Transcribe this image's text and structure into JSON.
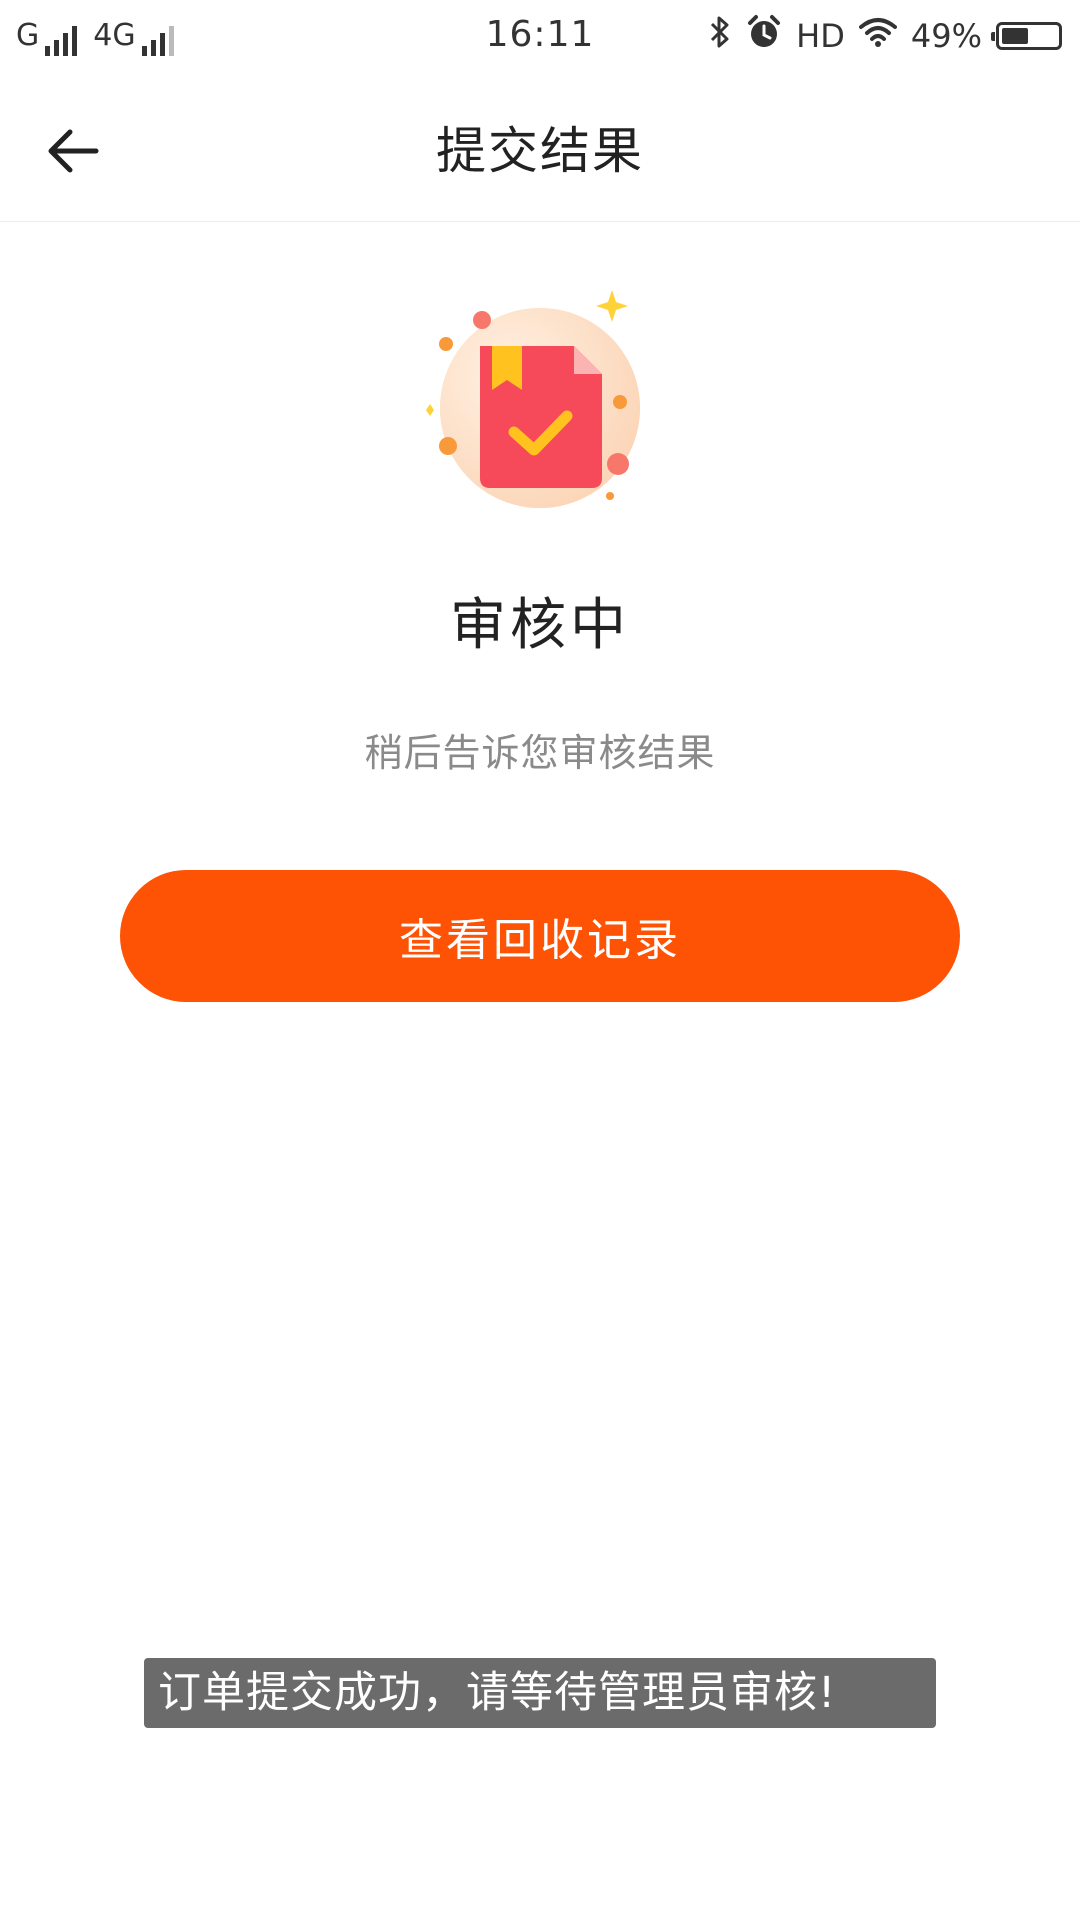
{
  "status_bar": {
    "carrier_1": "G",
    "carrier_2": "4G",
    "time": "16:11",
    "hd_label": "HD",
    "battery_percent": "49%",
    "battery_level": 0.49,
    "icons": [
      "signal-icon",
      "bluetooth-icon",
      "alarm-icon",
      "wifi-icon",
      "battery-icon"
    ]
  },
  "header": {
    "title": "提交结果",
    "back_icon": "arrow-left-icon"
  },
  "result": {
    "illustration_icon": "document-check-icon",
    "status_title": "审核中",
    "status_subtitle": "稍后告诉您审核结果",
    "button_label": "查看回收记录"
  },
  "toast": {
    "message": "订单提交成功，请等待管理员审核!"
  },
  "colors": {
    "accent": "#fe5305",
    "document": "#f6495a",
    "check": "#ffc21f",
    "circle_bg": "#fde3cc",
    "toast_bg": "#6b6b6b"
  }
}
